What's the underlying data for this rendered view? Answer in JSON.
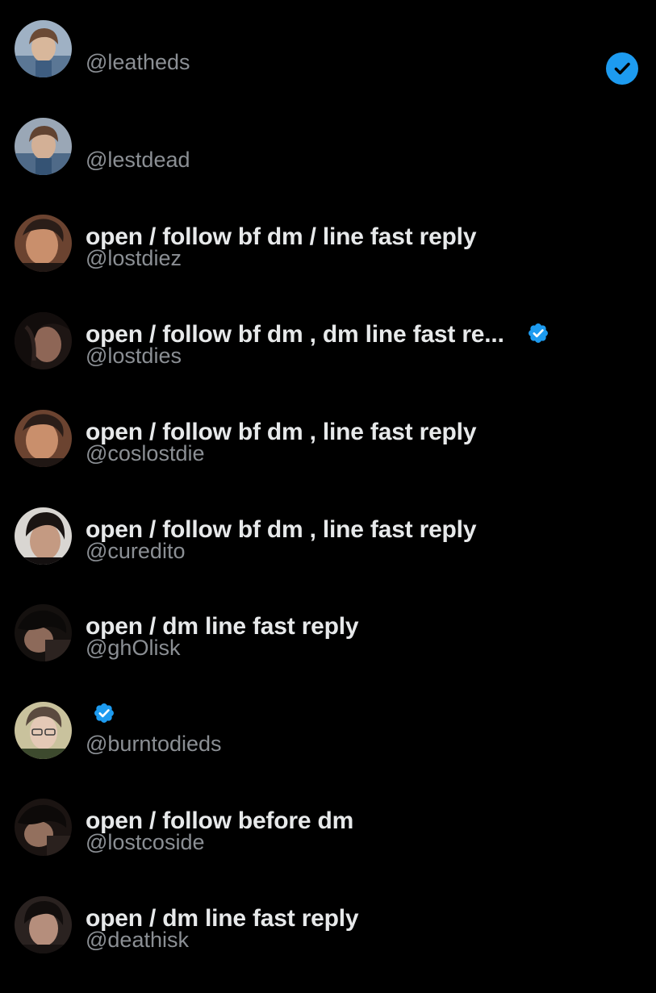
{
  "accounts": [
    {
      "name": "",
      "handle": "@leatheds",
      "verified": false,
      "selected": true,
      "avatar_tone": "#8a9bb0"
    },
    {
      "name": "",
      "handle": "@lestdead",
      "verified": false,
      "selected": false,
      "avatar_tone": "#7d8796"
    },
    {
      "name": "open / follow bf dm / line fast reply",
      "handle": "@lostdiez",
      "verified": false,
      "selected": false,
      "avatar_tone": "#a8745a"
    },
    {
      "name": "open / follow bf dm , dm line fast re...",
      "handle": "@lostdies",
      "verified": true,
      "selected": false,
      "avatar_tone": "#4a3631"
    },
    {
      "name": "open / follow bf dm , line fast reply",
      "handle": "@coslostdie",
      "verified": false,
      "selected": false,
      "avatar_tone": "#a8745a"
    },
    {
      "name": "open / follow bf dm , line fast reply",
      "handle": "@curedito",
      "verified": false,
      "selected": false,
      "avatar_tone": "#3f3532"
    },
    {
      "name": "open / dm line fast reply",
      "handle": "@ghOlisk",
      "verified": false,
      "selected": false,
      "avatar_tone": "#2b2624"
    },
    {
      "name": "",
      "handle": "@burntodieds",
      "verified": true,
      "selected": false,
      "avatar_tone": "#b7ad88"
    },
    {
      "name": "open / follow before dm",
      "handle": "@lostcoside",
      "verified": false,
      "selected": false,
      "avatar_tone": "#3a2c28"
    },
    {
      "name": "open / dm line fast reply",
      "handle": "@deathisk",
      "verified": false,
      "selected": false,
      "avatar_tone": "#4c3d39"
    }
  ],
  "colors": {
    "background": "#000000",
    "name_text": "#e7e9ea",
    "handle_text": "#8b8f94",
    "verified_blue": "#1d9bf0",
    "select_blue": "#1d9bf0"
  },
  "icons": {
    "verified": "verified-badge-icon",
    "selected": "checkmark-circle-icon"
  }
}
